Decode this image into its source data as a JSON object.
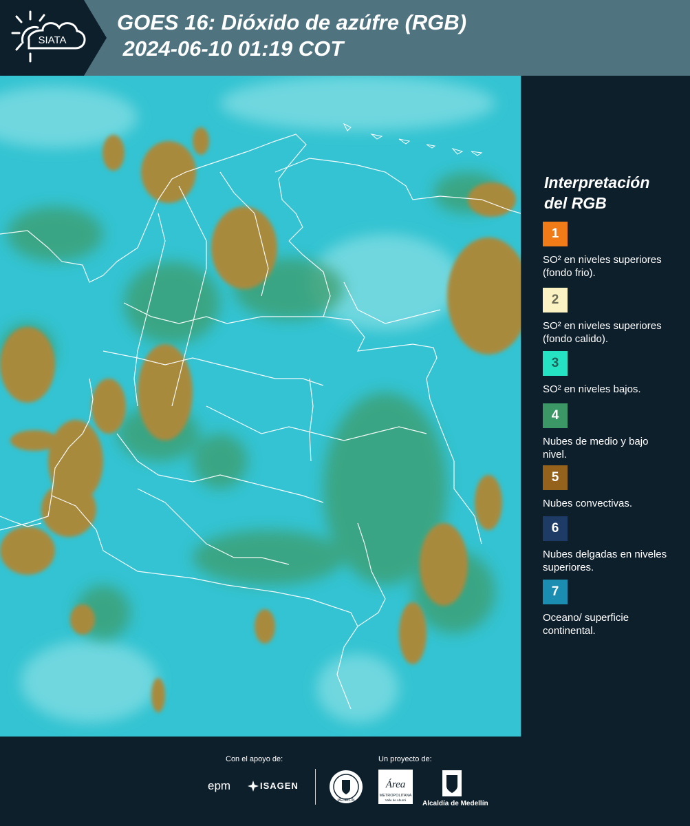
{
  "header": {
    "logo_text": "SIATA",
    "title": "GOES 16: Dióxido de azúfre (RGB)\n 2024-06-10 01:19 COT"
  },
  "legend": {
    "title": "Interpretación\ndel RGB",
    "items": [
      {
        "number": "1",
        "label": "SO² en niveles superiores (fondo frio).",
        "color": "#f07b17",
        "text_color": "#ffffff"
      },
      {
        "number": "2",
        "label": "SO² en niveles superiores (fondo calido).",
        "color": "#fbf2c4",
        "text_color": "#6b6b55"
      },
      {
        "number": "3",
        "label": "SO² en niveles bajos.",
        "color": "#25e2c3",
        "text_color": "#1f5f58"
      },
      {
        "number": "4",
        "label": "Nubes de medio y bajo nivel.",
        "color": "#3c9766",
        "text_color": "#ffffff"
      },
      {
        "number": "5",
        "label": "Nubes convectivas.",
        "color": "#95621c",
        "text_color": "#ffffff"
      },
      {
        "number": "6",
        "label": "Nubes delgadas en niveles superiores.",
        "color": "#1e3b66",
        "text_color": "#ffffff"
      },
      {
        "number": "7",
        "label": "Oceano/ superficie continental.",
        "color": "#1b8db0",
        "text_color": "#ffffff"
      }
    ]
  },
  "footer": {
    "support_label": "Con el apoyo de:",
    "project_label": "Un proyecto de:",
    "epm": "epm",
    "isagen": "ISAGEN",
    "medellin_seal": "MEDELLÍN",
    "area_name": "Área",
    "area_sub": "METROPOLITANA",
    "area_sub2": "Valle de Aburrá",
    "alcaldia": "Alcaldía de Medellín"
  }
}
